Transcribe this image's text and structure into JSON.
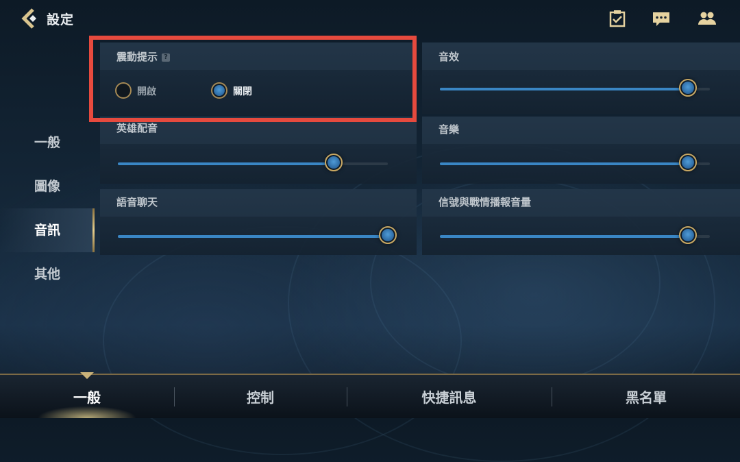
{
  "header": {
    "title": "設定",
    "icons": [
      "back-arrow-icon",
      "clipboard-check-icon",
      "chat-bubble-icon",
      "friends-icon"
    ]
  },
  "sidebar": {
    "items": [
      {
        "label": "一般",
        "active": false
      },
      {
        "label": "圖像",
        "active": false
      },
      {
        "label": "音訊",
        "active": true
      },
      {
        "label": "其他",
        "active": false
      }
    ]
  },
  "panels": {
    "vibration": {
      "title": "震動提示",
      "help_icon": "help-icon",
      "options": [
        {
          "label": "開啟",
          "checked": false
        },
        {
          "label": "關閉",
          "checked": true
        }
      ]
    },
    "sound_effects": {
      "title": "音效",
      "level": 0.92
    },
    "hero_voice": {
      "title": "英雄配音",
      "level": 0.8
    },
    "music": {
      "title": "音樂",
      "level": 0.92
    },
    "voice_chat": {
      "title": "語音聊天",
      "level": 1.0
    },
    "signal_volume": {
      "title": "信號與戰情播報音量",
      "level": 0.92
    }
  },
  "bottom_tabs": [
    {
      "label": "一般",
      "active": true
    },
    {
      "label": "控制",
      "active": false
    },
    {
      "label": "快捷訊息",
      "active": false
    },
    {
      "label": "黑名單",
      "active": false
    }
  ],
  "colors": {
    "accent_blue": "#3a86c4",
    "gold": "#c9a862",
    "highlight_red": "#e64a3e"
  }
}
